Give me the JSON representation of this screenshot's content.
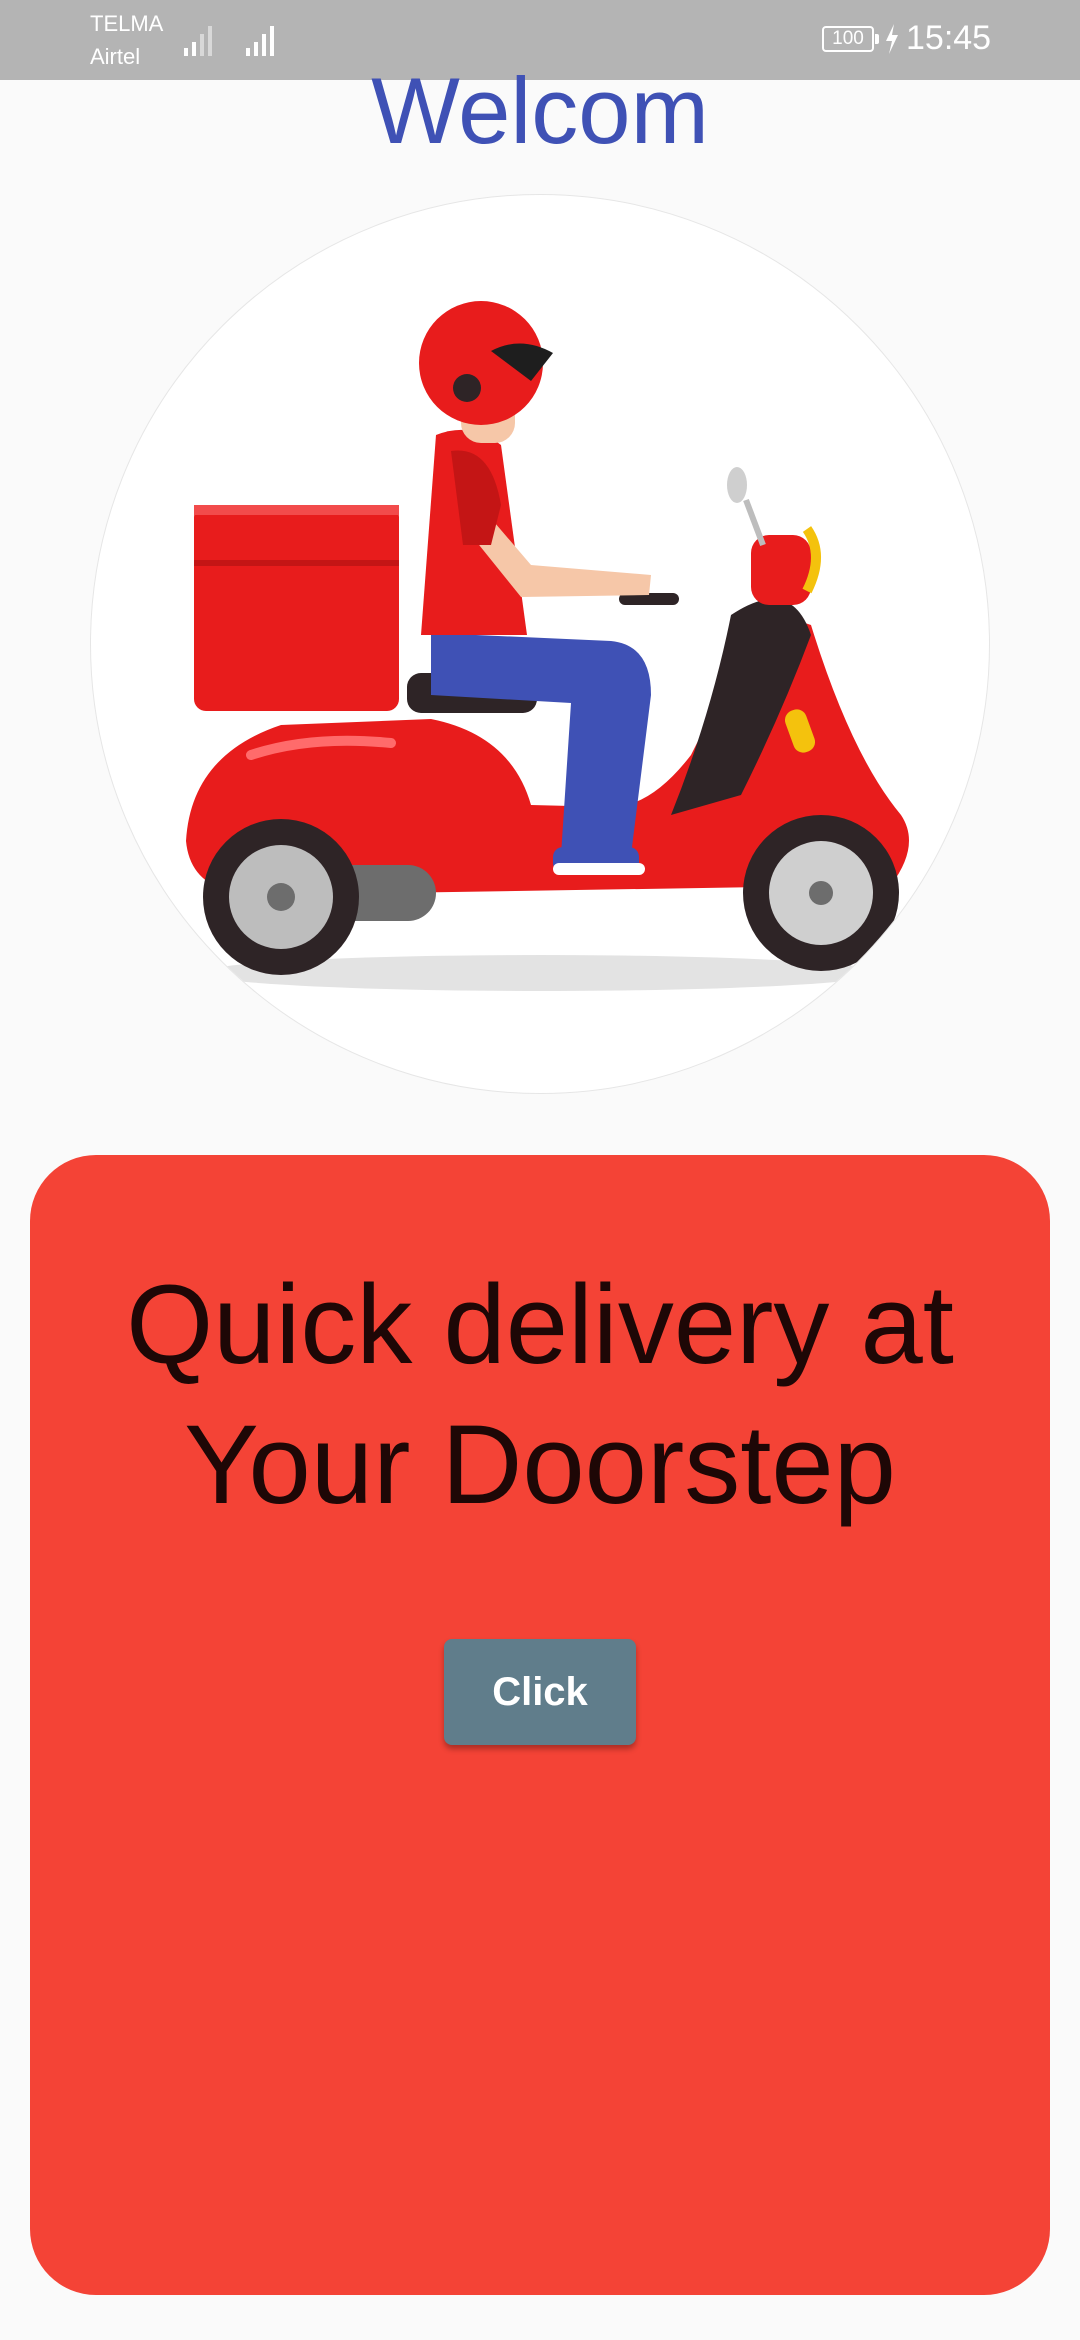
{
  "status_bar": {
    "carrier_1": "TELMA",
    "carrier_2": "Airtel",
    "battery": "100",
    "time": "15:45",
    "icons": [
      "signal-icon",
      "signal-icon",
      "battery-icon",
      "charging-bolt-icon"
    ]
  },
  "header": {
    "title": "Welcom"
  },
  "hero": {
    "image": "delivery-scooter-illustration"
  },
  "card": {
    "tagline_line1": "Quick delivery at",
    "tagline_line2": "Your Doorstep",
    "button_label": "Click"
  },
  "colors": {
    "title": "#3f51b5",
    "card": "#f44336",
    "button": "#607d8b",
    "status_bar": "#b4b4b4"
  }
}
